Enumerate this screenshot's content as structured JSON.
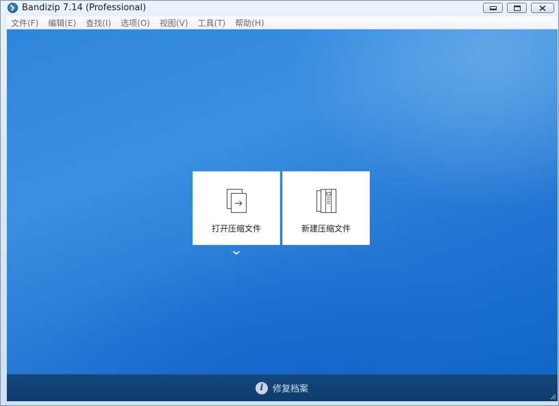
{
  "window": {
    "title": "Bandizip 7.14 (Professional)"
  },
  "menu": [
    {
      "label": "文件(F)"
    },
    {
      "label": "编辑(E)"
    },
    {
      "label": "查找(I)"
    },
    {
      "label": "选项(O)"
    },
    {
      "label": "视图(V)"
    },
    {
      "label": "工具(T)"
    },
    {
      "label": "帮助(H)"
    }
  ],
  "main": {
    "open_archive_label": "打开压缩文件",
    "new_archive_label": "新建压缩文件"
  },
  "statusbar": {
    "repair_label": "修复档案"
  },
  "icons": {
    "app": "bandizip-logo-icon",
    "open": "open-archive-icon",
    "create": "new-archive-icon",
    "dropdown": "chevron-down-icon",
    "info": "info-icon"
  },
  "colors": {
    "background_blue": "#2e86dc",
    "statusbar_navy": "#13477c"
  }
}
